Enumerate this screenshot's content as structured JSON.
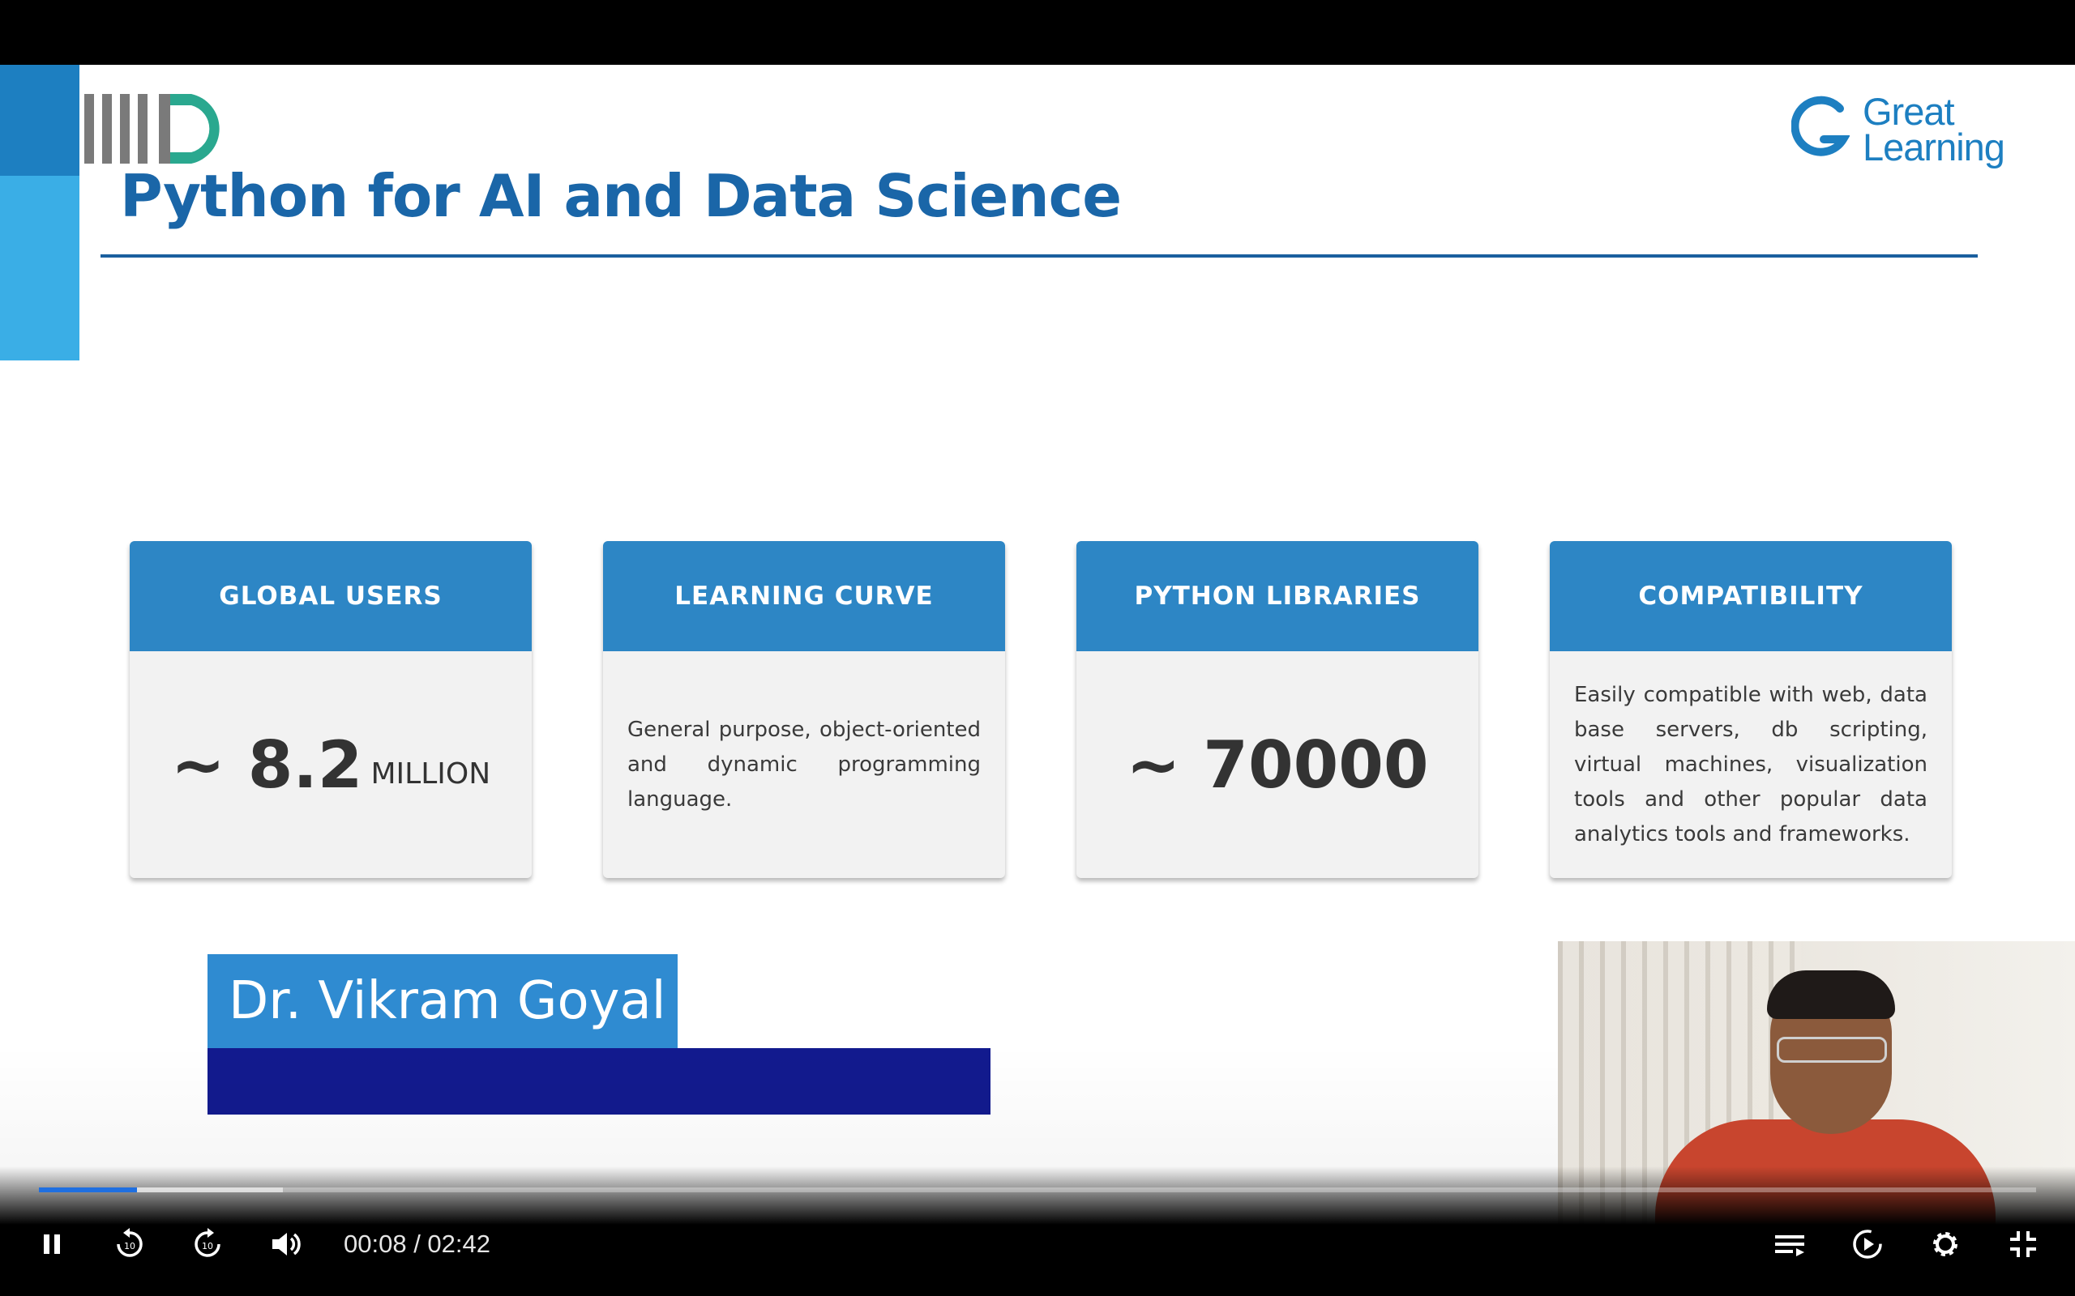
{
  "slide": {
    "title": "Python for AI and Data Science",
    "brand_line1": "Great",
    "brand_line2": "Learning",
    "cards": [
      {
        "heading": "GLOBAL USERS",
        "stat": "~ 8.2",
        "unit": "MILLION"
      },
      {
        "heading": "LEARNING CURVE",
        "text": "General purpose, object-oriented and dynamic programming language."
      },
      {
        "heading": "PYTHON LIBRARIES",
        "stat": "~ 70000"
      },
      {
        "heading": "COMPATIBILITY",
        "text": "Easily compatible with web, data base servers, db scripting, virtual machines, visualization tools and other popular data analytics tools and frameworks."
      }
    ],
    "presenter": "Dr. Vikram Goyal"
  },
  "player": {
    "time_current": "00:08",
    "time_separator": " / ",
    "time_total": "02:42",
    "played_fraction": 0.049,
    "buffered_fraction": 0.122,
    "icons": {
      "play_pause": "pause-icon",
      "rewind": "rewind-10-icon",
      "forward": "forward-10-icon",
      "volume": "volume-icon",
      "chapters": "chapters-icon",
      "autoplay": "autoplay-icon",
      "settings": "gear-icon",
      "fullscreen": "exit-fullscreen-icon"
    },
    "colors": {
      "progress": "#1f6fe0",
      "accent_blue": "#2d86c5"
    }
  }
}
